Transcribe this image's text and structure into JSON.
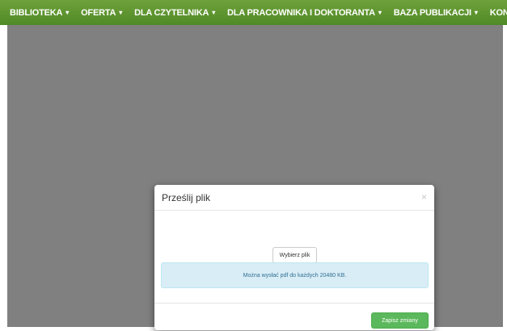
{
  "nav": {
    "items": [
      {
        "label": "BIBLIOTEKA",
        "caret": "▾"
      },
      {
        "label": "OFERTA",
        "caret": "▾"
      },
      {
        "label": "DLA CZYTELNIKA",
        "caret": "▾"
      },
      {
        "label": "DLA PRACOWNIKA I DOKTORANTA",
        "caret": "▾"
      },
      {
        "label": "BAZA PUBLIKACJI",
        "caret": "▾"
      },
      {
        "label": "KONT",
        "caret": ""
      }
    ]
  },
  "modal": {
    "title": "Prześlij plik",
    "close": "×",
    "choose_file_label": "Wybierz plik",
    "info_text": "Można wysłać pdf do każdych 20480 KB.",
    "save_label": "Zapisz zmiany"
  },
  "colors": {
    "nav_green": "#5a9430",
    "overlay_grey": "#808080",
    "info_bg": "#d9edf7",
    "save_green": "#5cb85c"
  }
}
